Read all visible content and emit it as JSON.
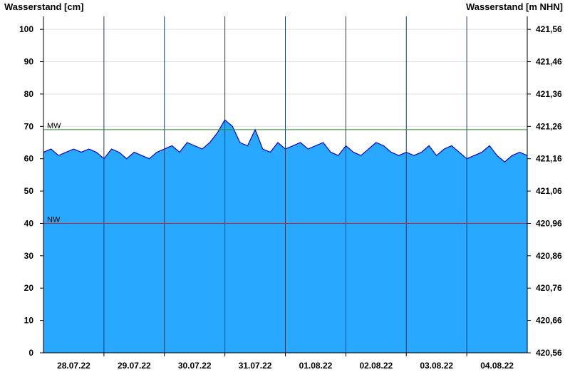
{
  "chart_data": {
    "type": "area",
    "left_axis_title": "Wasserstand [cm]",
    "right_axis_title": "Wasserstand [m NHN]",
    "ylim": [
      0,
      104
    ],
    "y_ticks": [
      0,
      10,
      20,
      30,
      40,
      50,
      60,
      70,
      80,
      90,
      100
    ],
    "y_tick_labels": [
      "0",
      "10",
      "20",
      "30",
      "40",
      "50",
      "60",
      "70",
      "80",
      "90",
      "100"
    ],
    "y2_tick_labels": [
      "420,56",
      "420,66",
      "420,76",
      "420,86",
      "420,96",
      "421,06",
      "421,16",
      "421,26",
      "421,36",
      "421,46",
      "421,56"
    ],
    "x_start": "2022-07-27 12:00",
    "x_end": "2022-08-04 12:00",
    "day_labels": [
      {
        "date": "2022-07-28",
        "label": "28.07.22"
      },
      {
        "date": "2022-07-29",
        "label": "29.07.22"
      },
      {
        "date": "2022-07-30",
        "label": "30.07.22"
      },
      {
        "date": "2022-07-31",
        "label": "31.07.22"
      },
      {
        "date": "2022-08-01",
        "label": "01.08.22"
      },
      {
        "date": "2022-08-02",
        "label": "02.08.22"
      },
      {
        "date": "2022-08-03",
        "label": "03.08.22"
      },
      {
        "date": "2022-08-04",
        "label": "04.08.22"
      }
    ],
    "reference_lines": [
      {
        "label": "MW",
        "value": 69,
        "color": "#2e8b2e"
      },
      {
        "label": "NW",
        "value": 40,
        "color": "#cc2222"
      }
    ],
    "series": [
      {
        "fill_color": "#29a8ff",
        "line_color": "#0000cc",
        "points": [
          [
            "2022-07-27 12:00",
            62
          ],
          [
            "2022-07-27 15:00",
            63
          ],
          [
            "2022-07-27 18:00",
            61
          ],
          [
            "2022-07-27 21:00",
            62
          ],
          [
            "2022-07-28 00:00",
            63
          ],
          [
            "2022-07-28 03:00",
            62
          ],
          [
            "2022-07-28 06:00",
            63
          ],
          [
            "2022-07-28 09:00",
            62
          ],
          [
            "2022-07-28 12:00",
            60
          ],
          [
            "2022-07-28 15:00",
            63
          ],
          [
            "2022-07-28 18:00",
            62
          ],
          [
            "2022-07-28 21:00",
            60
          ],
          [
            "2022-07-29 00:00",
            62
          ],
          [
            "2022-07-29 03:00",
            61
          ],
          [
            "2022-07-29 06:00",
            60
          ],
          [
            "2022-07-29 09:00",
            62
          ],
          [
            "2022-07-29 12:00",
            63
          ],
          [
            "2022-07-29 15:00",
            64
          ],
          [
            "2022-07-29 18:00",
            62
          ],
          [
            "2022-07-29 21:00",
            65
          ],
          [
            "2022-07-30 00:00",
            64
          ],
          [
            "2022-07-30 03:00",
            63
          ],
          [
            "2022-07-30 06:00",
            65
          ],
          [
            "2022-07-30 09:00",
            68
          ],
          [
            "2022-07-30 12:00",
            72
          ],
          [
            "2022-07-30 15:00",
            70
          ],
          [
            "2022-07-30 18:00",
            65
          ],
          [
            "2022-07-30 21:00",
            64
          ],
          [
            "2022-07-31 00:00",
            69
          ],
          [
            "2022-07-31 03:00",
            63
          ],
          [
            "2022-07-31 06:00",
            62
          ],
          [
            "2022-07-31 09:00",
            65
          ],
          [
            "2022-07-31 12:00",
            63
          ],
          [
            "2022-07-31 15:00",
            64
          ],
          [
            "2022-07-31 18:00",
            65
          ],
          [
            "2022-07-31 21:00",
            63
          ],
          [
            "2022-08-01 00:00",
            64
          ],
          [
            "2022-08-01 03:00",
            65
          ],
          [
            "2022-08-01 06:00",
            62
          ],
          [
            "2022-08-01 09:00",
            61
          ],
          [
            "2022-08-01 12:00",
            64
          ],
          [
            "2022-08-01 15:00",
            62
          ],
          [
            "2022-08-01 18:00",
            61
          ],
          [
            "2022-08-01 21:00",
            63
          ],
          [
            "2022-08-02 00:00",
            65
          ],
          [
            "2022-08-02 03:00",
            64
          ],
          [
            "2022-08-02 06:00",
            62
          ],
          [
            "2022-08-02 09:00",
            61
          ],
          [
            "2022-08-02 12:00",
            62
          ],
          [
            "2022-08-02 15:00",
            61
          ],
          [
            "2022-08-02 18:00",
            62
          ],
          [
            "2022-08-02 21:00",
            64
          ],
          [
            "2022-08-03 00:00",
            61
          ],
          [
            "2022-08-03 03:00",
            63
          ],
          [
            "2022-08-03 06:00",
            64
          ],
          [
            "2022-08-03 09:00",
            62
          ],
          [
            "2022-08-03 12:00",
            60
          ],
          [
            "2022-08-03 15:00",
            61
          ],
          [
            "2022-08-03 18:00",
            62
          ],
          [
            "2022-08-03 21:00",
            64
          ],
          [
            "2022-08-04 00:00",
            61
          ],
          [
            "2022-08-04 03:00",
            59
          ],
          [
            "2022-08-04 06:00",
            61
          ],
          [
            "2022-08-04 09:00",
            62
          ],
          [
            "2022-08-04 12:00",
            61
          ]
        ]
      }
    ]
  }
}
